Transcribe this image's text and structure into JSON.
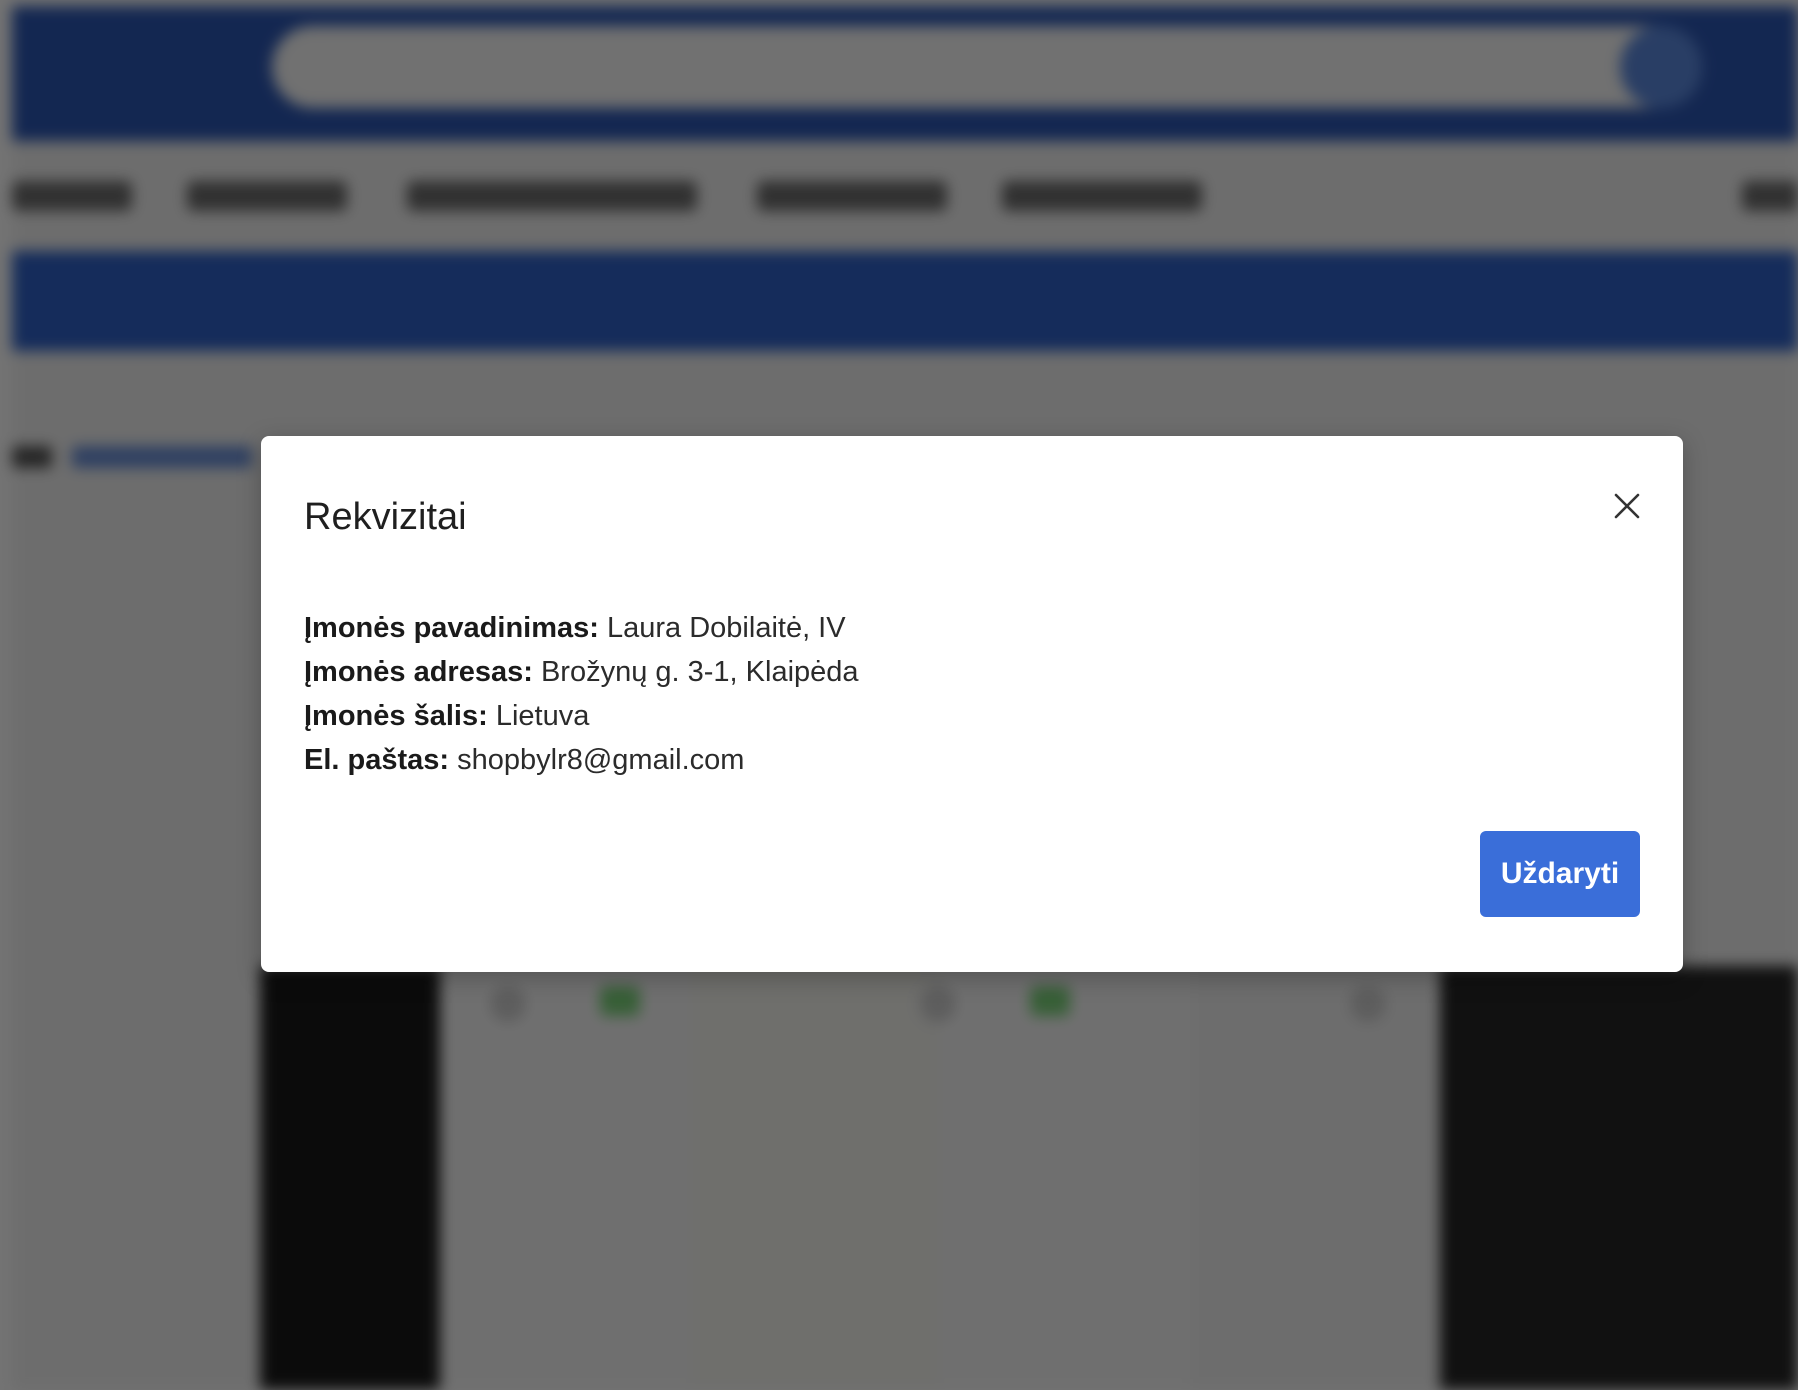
{
  "modal": {
    "title": "Rekvizitai",
    "fields": [
      {
        "label": "Įmonės pavadinimas:",
        "value": "Laura Dobilaitė, IV"
      },
      {
        "label": "Įmonės adresas:",
        "value": "Brožynų g. 3-1, Klaipėda"
      },
      {
        "label": "Įmonės šalis:",
        "value": "Lietuva"
      },
      {
        "label": "El. paštas:",
        "value": "shopbylr8@gmail.com"
      }
    ],
    "close_icon": "close-icon",
    "confirm_label": "Uždaryti"
  },
  "colors": {
    "header": "#2c57b4",
    "primary_button": "#3a6ed9",
    "overlay": "rgba(0,0,0,0.55)"
  }
}
